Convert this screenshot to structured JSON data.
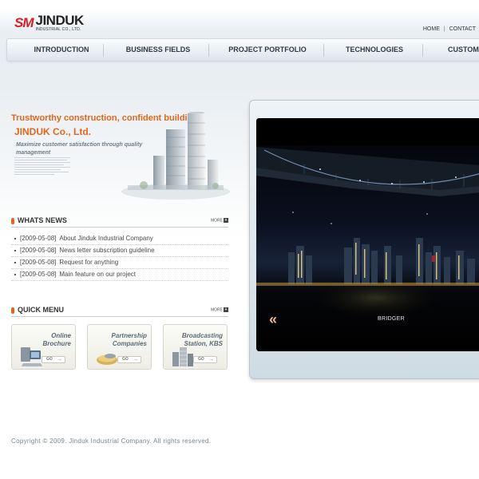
{
  "header": {
    "logo_mark": "SM",
    "logo_name": "JINDUK",
    "logo_sub": "INDUSTRIAL CO., LTD.",
    "links": [
      "HOME",
      "CONTACT"
    ]
  },
  "nav": {
    "items": [
      "INTRODUCTION",
      "BUSINESS FIELDS",
      "PROJECT PORTFOLIO",
      "TECHNOLOGIES",
      "CUSTOMER"
    ]
  },
  "intro": {
    "headline": "Trustworthy construction, confident building,",
    "company": "JINDUK Co., Ltd.",
    "tagline": "Maximize customer satisfaction through quality management"
  },
  "news": {
    "title": "WHATS NEWS",
    "more": "MORE",
    "items": [
      {
        "date": "[2009-05-08]",
        "text": "About Jinduk Industrial Company"
      },
      {
        "date": "[2009-05-08]",
        "text": "News letter subscription guideline"
      },
      {
        "date": "[2009-05-08]",
        "text": "Request for anything"
      },
      {
        "date": "[2009-05-08]",
        "text": "Main feature on our project"
      }
    ]
  },
  "quick": {
    "title": "QUICK MENU",
    "more": "MORE",
    "go_label": "GO",
    "cards": [
      {
        "line1": "Online",
        "line2": "Brochure",
        "icon": "computer-icon"
      },
      {
        "line1": "Partnership",
        "line2": "Companies",
        "icon": "handshake-icon"
      },
      {
        "line1": "Broadcasting",
        "line2": "Station, KBS",
        "icon": "building-icon"
      }
    ]
  },
  "showcase": {
    "caption": "BRIDGER",
    "prev_label": "«"
  },
  "footer": {
    "copyright": "Copyright © 2009. Jinduk Industrial Company. All rights reserved."
  },
  "colors": {
    "accent": "#e2661b",
    "brand_red": "#d81e24",
    "nav_text": "#2f3a44"
  }
}
